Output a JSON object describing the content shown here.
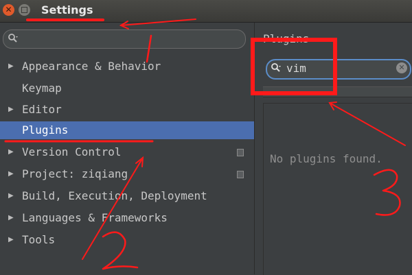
{
  "window": {
    "title": "Settings",
    "close_glyph": "✕"
  },
  "sidebar": {
    "search": {
      "value": "",
      "icon": "search-icon"
    },
    "items": [
      {
        "label": "Appearance & Behavior",
        "expandable": true,
        "selected": false
      },
      {
        "label": "Keymap",
        "expandable": false,
        "selected": false
      },
      {
        "label": "Editor",
        "expandable": true,
        "selected": false
      },
      {
        "label": "Plugins",
        "expandable": false,
        "selected": true
      },
      {
        "label": "Version Control",
        "expandable": true,
        "selected": false,
        "project_icon": true
      },
      {
        "label": "Project: ziqiang",
        "expandable": true,
        "selected": false,
        "project_icon": true
      },
      {
        "label": "Build, Execution, Deployment",
        "expandable": true,
        "selected": false
      },
      {
        "label": "Languages & Frameworks",
        "expandable": true,
        "selected": false
      },
      {
        "label": "Tools",
        "expandable": true,
        "selected": false
      }
    ],
    "expand_glyph": "▶"
  },
  "main": {
    "title": "Plugins",
    "search": {
      "value": "vim",
      "clear_glyph": "✕"
    },
    "empty_text": "No plugins found."
  },
  "annotations": {
    "color": "#ff1a1a",
    "labels": [
      "1",
      "2",
      "3"
    ]
  }
}
